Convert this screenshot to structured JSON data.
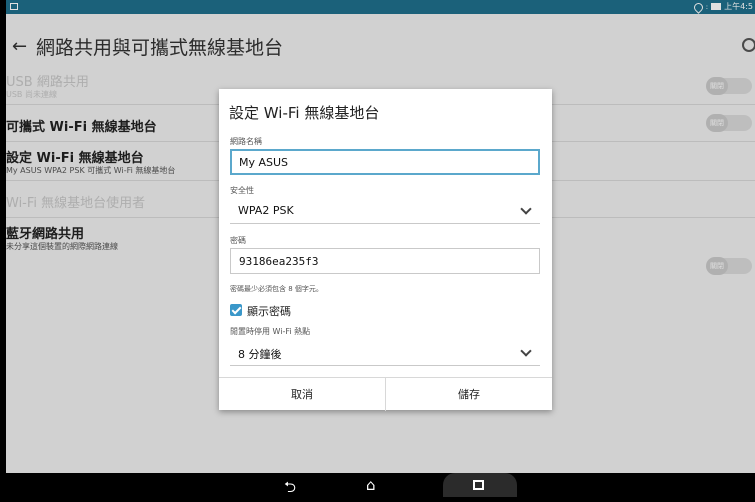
{
  "status_bar": {
    "time": "上午4:5"
  },
  "app_bar": {
    "title": "網路共用與可攜式無線基地台"
  },
  "settings": [
    {
      "title": "USB 網路共用",
      "subtitle": "USB 尚未連線",
      "toggle": "關閉",
      "enabled": false
    },
    {
      "title": "可攜式 Wi-Fi 無線基地台",
      "subtitle": "",
      "toggle": "關閉",
      "enabled": true
    },
    {
      "title": "設定 Wi-Fi 無線基地台",
      "subtitle": "My ASUS WPA2 PSK 可攜式 Wi-Fi 無線基地台",
      "toggle": "",
      "enabled": true
    },
    {
      "title": "Wi-Fi 無線基地台使用者",
      "subtitle": "",
      "toggle": "",
      "enabled": false
    },
    {
      "title": "藍牙網路共用",
      "subtitle": "未分享這個裝置的網際網路連線",
      "toggle": "關閉",
      "enabled": true
    }
  ],
  "dialog": {
    "title": "設定 Wi-Fi 無線基地台",
    "network_name_label": "網路名稱",
    "network_name_value": "My ASUS",
    "security_label": "安全性",
    "security_value": "WPA2 PSK",
    "password_label": "密碼",
    "password_value": "93186ea235f3",
    "password_hint": "密碼最少必須包含 8 個字元。",
    "show_password_label": "顯示密碼",
    "show_password_checked": true,
    "idle_label": "閒置時停用 Wi-Fi 熱點",
    "idle_value": "8 分鐘後",
    "cancel_label": "取消",
    "save_label": "儲存"
  },
  "colors": {
    "status_bar": "#1f6f8b",
    "accent": "#3a97c9",
    "focus_border": "#5ba8cc"
  },
  "icons": [
    "back-arrow-icon",
    "search-icon",
    "wifi-icon",
    "battery-icon",
    "nav-back-icon",
    "nav-home-icon",
    "nav-recent-icon"
  ]
}
